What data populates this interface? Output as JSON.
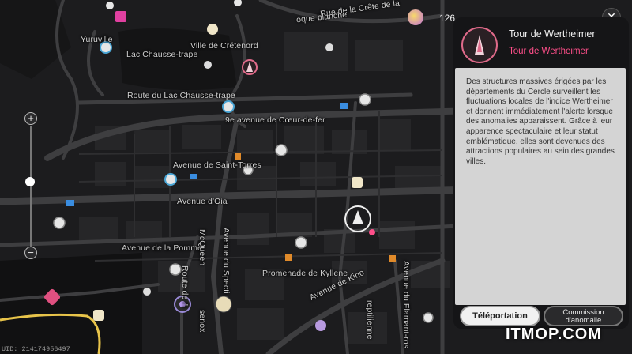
{
  "map": {
    "labels": [
      {
        "id": "yuruville",
        "text": "Yuruville"
      },
      {
        "id": "ville-cretenord",
        "text": "Ville de Crétenord"
      },
      {
        "id": "lac-chausse-trape",
        "text": "Lac Chausse-trape"
      },
      {
        "id": "route-lac",
        "text": "Route du Lac Chausse-trape"
      },
      {
        "id": "avenue-coeur",
        "text": "9e avenue de Cœur-de-fer"
      },
      {
        "id": "avenue-saint-torres",
        "text": "Avenue de Saint-Torres"
      },
      {
        "id": "avenue-oia",
        "text": "Avenue d'Oia"
      },
      {
        "id": "avenue-pomme",
        "text": "Avenue de la Pomme"
      },
      {
        "id": "promenade-kyllene",
        "text": "Promenade de Kyllene"
      },
      {
        "id": "avenue-kino",
        "text": "Avenue de Kino"
      },
      {
        "id": "route-crete",
        "text": "Rue de la Crête de la"
      },
      {
        "id": "rue-blanche",
        "text": "oque blanche"
      },
      {
        "id": "mcqueen",
        "text": "McQueen"
      },
      {
        "id": "avenue-spect",
        "text": "Avenue du Specti"
      },
      {
        "id": "route-ier",
        "text": "Route de l'I"
      },
      {
        "id": "flamant",
        "text": "Avenue du Flamant-ros"
      },
      {
        "id": "reptilienne",
        "text": "reptilienne"
      },
      {
        "id": "sanok",
        "text": "senox"
      }
    ]
  },
  "hud": {
    "currency_value": "126",
    "close_icon": "✕",
    "uid": "UID: 214174956497",
    "zoom_in": "+",
    "zoom_out": "−"
  },
  "panel": {
    "title": "Tour de Wertheimer",
    "subtitle": "Tour de Wertheimer",
    "description": "Des structures massives érigées par les départements du Cercle surveillent les fluctuations locales de l'indice Wertheimer et donnent immédiatement l'alerte lorsque des anomalies apparaissent. Grâce à leur apparence spectaculaire et leur statut emblématique, elles sont devenues des attractions populaires au sein des grandes villes.",
    "teleport_label": "Téléportation",
    "commission_label": "Commission d'anomalie",
    "accent_color": "#ff4f8a"
  },
  "watermark": "ITMOP.COM"
}
